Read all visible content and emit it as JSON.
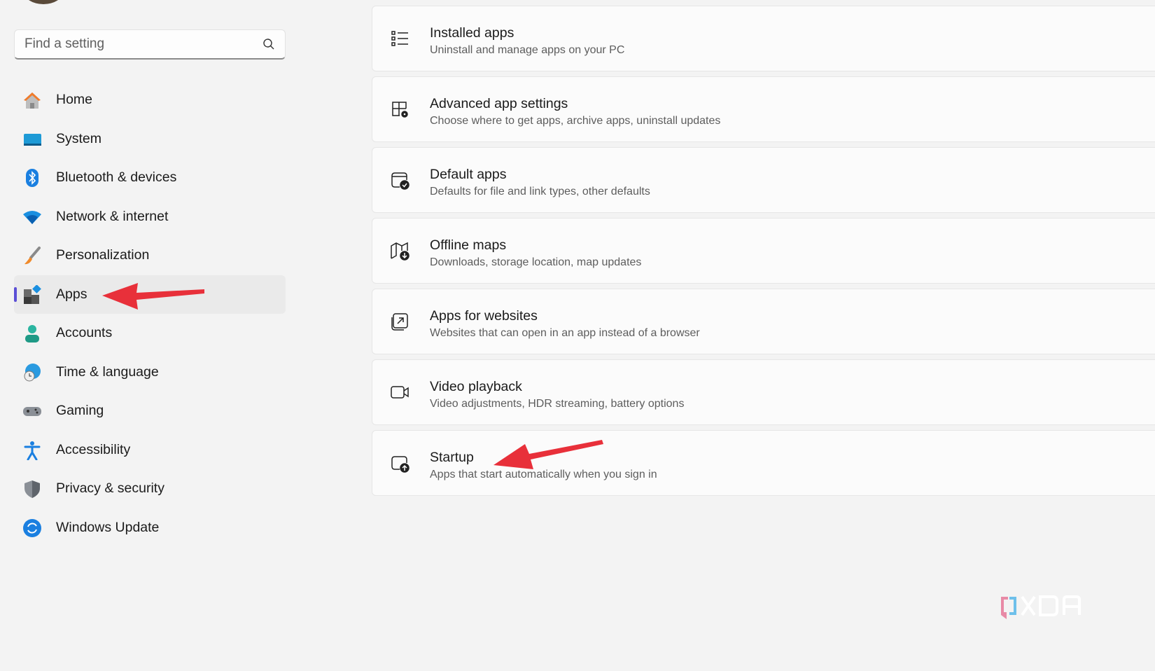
{
  "search": {
    "placeholder": "Find a setting"
  },
  "sidebar": {
    "items": [
      {
        "label": "Home"
      },
      {
        "label": "System"
      },
      {
        "label": "Bluetooth & devices"
      },
      {
        "label": "Network & internet"
      },
      {
        "label": "Personalization"
      },
      {
        "label": "Apps"
      },
      {
        "label": "Accounts"
      },
      {
        "label": "Time & language"
      },
      {
        "label": "Gaming"
      },
      {
        "label": "Accessibility"
      },
      {
        "label": "Privacy & security"
      },
      {
        "label": "Windows Update"
      }
    ],
    "active": "Apps",
    "accent": "#5b4fd6"
  },
  "cards": [
    {
      "title": "Installed apps",
      "subtitle": "Uninstall and manage apps on your PC"
    },
    {
      "title": "Advanced app settings",
      "subtitle": "Choose where to get apps, archive apps, uninstall updates"
    },
    {
      "title": "Default apps",
      "subtitle": "Defaults for file and link types, other defaults"
    },
    {
      "title": "Offline maps",
      "subtitle": "Downloads, storage location, map updates"
    },
    {
      "title": "Apps for websites",
      "subtitle": "Websites that can open in an app instead of a browser"
    },
    {
      "title": "Video playback",
      "subtitle": "Video adjustments, HDR streaming, battery options"
    },
    {
      "title": "Startup",
      "subtitle": "Apps that start automatically when you sign in"
    }
  ],
  "annotation_color": "#e8303a",
  "watermark": "XDA"
}
